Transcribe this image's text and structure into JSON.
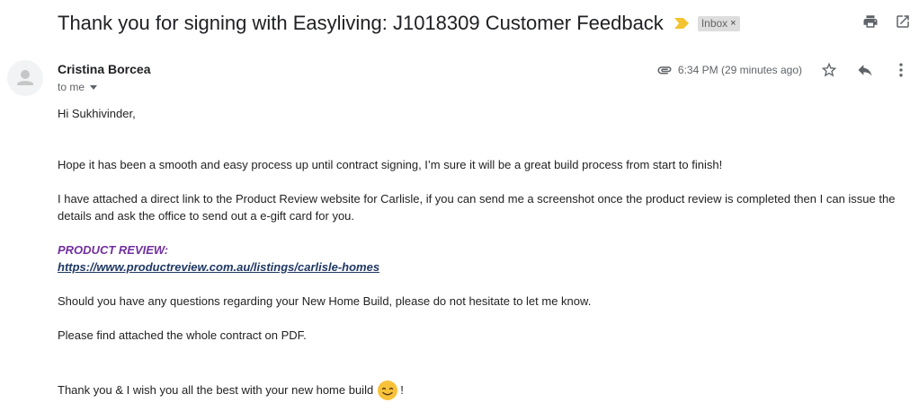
{
  "email": {
    "subject": "Thank you for signing with Easyliving: J1018309 Customer Feedback",
    "label": "Inbox",
    "label_remove": "×",
    "sender": "Cristina Borcea",
    "recipient": "to me",
    "timestamp": "6:34 PM (29 minutes ago)",
    "has_attachment": true
  },
  "icons": {
    "importance": "importance-marker-icon",
    "print": "print-icon",
    "open_new_window": "open-in-new-window-icon",
    "attachment": "attachment-icon",
    "star": "star-icon",
    "reply": "reply-icon",
    "more": "more-vert-icon",
    "avatar": "default-avatar-icon",
    "smiley": "smiling-face-emoji"
  },
  "body": {
    "greeting": "Hi Sukhivinder,",
    "para1": "Hope it has been a smooth and easy process up until contract signing, I’m sure it will be a great build process from start to finish!",
    "para2": "I have  attached a direct link to the Product Review website for Carlisle, if you can send me a screenshot once the product review is completed then I can issue the details and ask the office to send out a e-gift card for you.",
    "review_heading": "PRODUCT REVIEW:",
    "review_link": "https://www.productreview.com.au/listings/carlisle-homes",
    "para3": "Should you have any questions regarding your New Home Build,  please do not hesitate to let me know.",
    "para4": "Please find attached the whole contract on PDF.",
    "closing_text": "Thank you & I wish you all the best with your new home build",
    "closing_end": "!"
  },
  "colors": {
    "importance": "#f4c430",
    "review_heading": "#7030a0",
    "review_link": "#1f3864",
    "icon_gray": "#5f6368"
  }
}
